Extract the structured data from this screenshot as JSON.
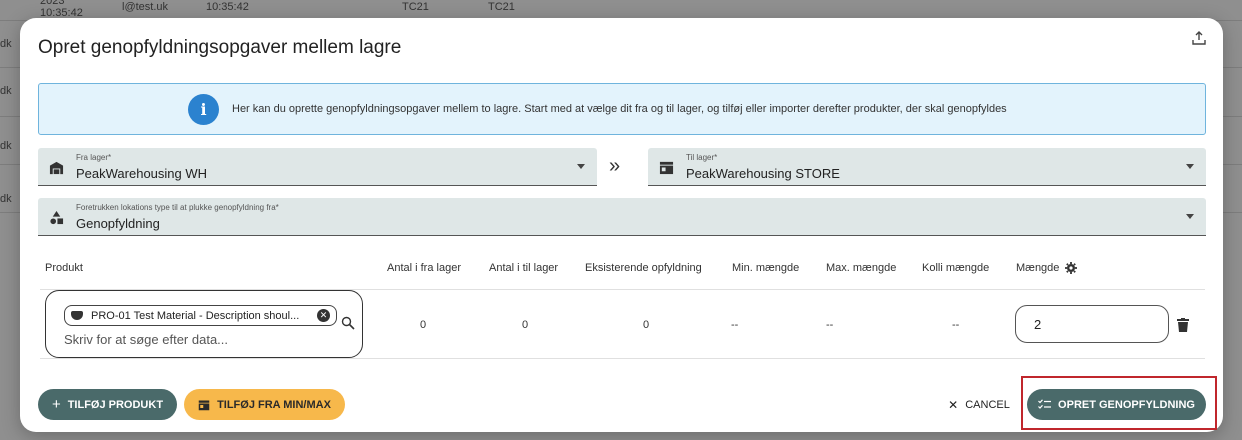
{
  "background": {
    "rows": [
      {
        "a": "2023",
        "b": "10:35:42",
        "c": "l@test.uk",
        "d": "10:35:42",
        "e": "TC21",
        "f": "TC21"
      },
      {
        "a": "dk"
      },
      {
        "a": "dk"
      },
      {
        "a": "dk"
      },
      {
        "a": "dk"
      }
    ]
  },
  "dialog": {
    "title": "Opret genopfyldningsopgaver mellem lagre",
    "export_icon": "upload-icon",
    "info": {
      "icon": "info-icon",
      "text": "Her kan du oprette genopfyldningsopgaver mellem to lagre. Start med at vælge dit fra og til lager, og tilføj eller importer derefter produkter, der skal genopfyldes"
    },
    "from_warehouse": {
      "label": "Fra lager*",
      "value": "PeakWarehousing WH",
      "icon": "warehouse-icon"
    },
    "to_warehouse": {
      "label": "Til lager*",
      "value": "PeakWarehousing STORE",
      "icon": "store-icon"
    },
    "swap_icon": "»",
    "location_type": {
      "label": "Foretrukken lokations type til at plukke genopfyldning fra*",
      "value": "Genopfyldning",
      "icon": "shapes-icon"
    },
    "table": {
      "headers": {
        "product": "Produkt",
        "qty_from": "Antal i fra lager",
        "qty_to": "Antal i til lager",
        "existing": "Eksisterende opfyldning",
        "min": "Min. mængde",
        "max": "Max. mængde",
        "colli": "Kolli mængde",
        "amount": "Mængde"
      },
      "row": {
        "product_chip": "PRO-01 Test Material - Description shoul...",
        "search_placeholder": "Skriv for at søge efter data...",
        "qty_from": "0",
        "qty_to": "0",
        "existing": "0",
        "min": "--",
        "max": "--",
        "colli": "--",
        "amount": "2"
      }
    },
    "buttons": {
      "add_product": "TILFØJ PRODUKT",
      "add_minmax": "TILFØJ FRA MIN/MAX",
      "cancel": "CANCEL",
      "create": "OPRET GENOPFYLDNING"
    },
    "colors": {
      "primary": "#4a6a6a",
      "accent": "#f7b84b",
      "info_bg": "#e3f3fc",
      "info_icon": "#2b82cf",
      "highlight": "#c0262c"
    }
  }
}
